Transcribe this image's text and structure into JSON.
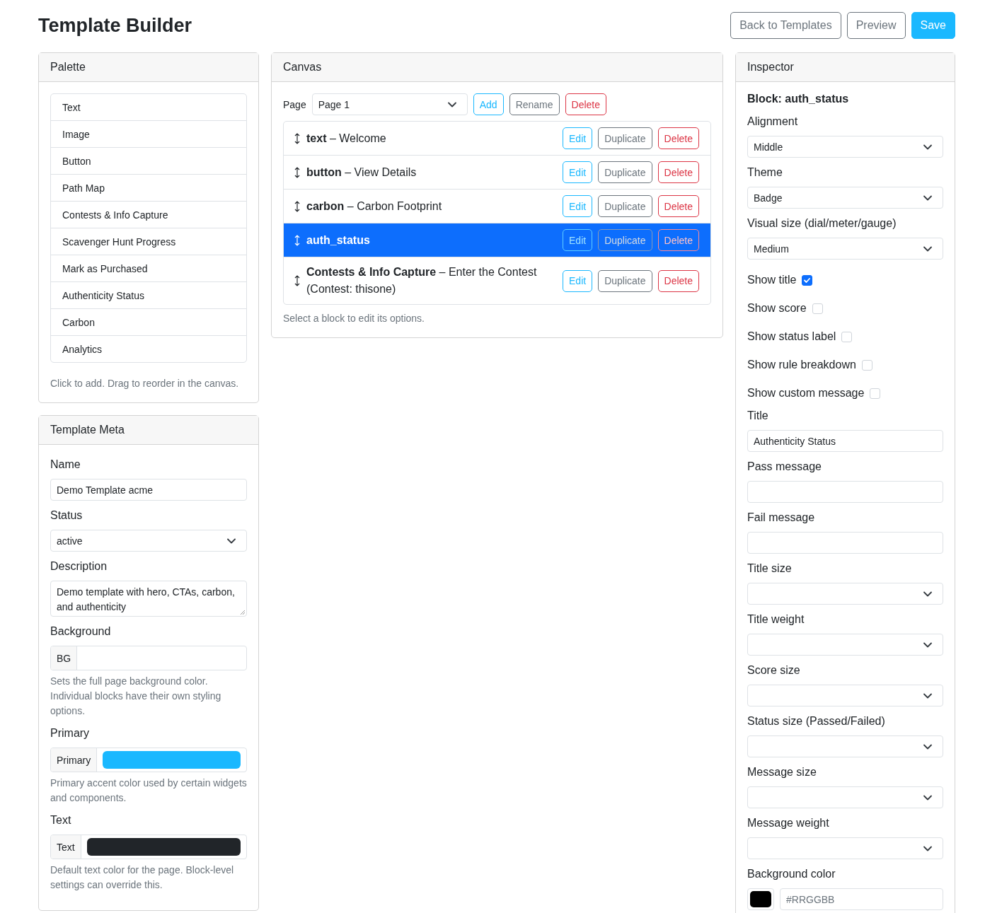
{
  "header": {
    "title": "Template Builder",
    "buttons": [
      {
        "label": "Back to Templates",
        "kind": "secondary"
      },
      {
        "label": "Preview",
        "kind": "secondary"
      },
      {
        "label": "Save",
        "kind": "primary"
      }
    ]
  },
  "palette": {
    "title": "Palette",
    "items": [
      "Text",
      "Image",
      "Button",
      "Path Map",
      "Contests & Info Capture",
      "Scavenger Hunt Progress",
      "Mark as Purchased",
      "Authenticity Status",
      "Carbon",
      "Analytics"
    ],
    "hint": "Click to add. Drag to reorder in the canvas."
  },
  "meta": {
    "title": "Template Meta",
    "fields": [
      {
        "kind": "text",
        "label": "Name",
        "value": "Demo Template acme"
      },
      {
        "kind": "select",
        "label": "Status",
        "value": "active"
      },
      {
        "kind": "textarea",
        "label": "Description",
        "value": "Demo template with hero, CTAs, carbon, and authenticity"
      },
      {
        "kind": "color_group",
        "label": "Background",
        "addon": "BG",
        "help": "Sets the full page background color. Individual blocks have their own styling options."
      },
      {
        "kind": "color_group",
        "label": "Primary",
        "addon": "Primary",
        "color": "#1ab8ff",
        "help": "Primary accent color used by certain widgets and components."
      },
      {
        "kind": "color_group",
        "label": "Text",
        "addon": "Text",
        "color": "#212529",
        "help": "Default text color for the page. Block-level settings can override this."
      }
    ]
  },
  "canvas": {
    "title": "Canvas",
    "page_label": "Page",
    "page": "Page 1",
    "page_buttons": [
      {
        "label": "Add",
        "kind": "info"
      },
      {
        "label": "Rename",
        "kind": "secondary"
      },
      {
        "label": "Delete",
        "kind": "danger"
      }
    ],
    "blocks": [
      {
        "label": "**text** – Welcome",
        "selected": false,
        "actions": [
          {
            "label": "Edit",
            "kind": "info"
          },
          {
            "label": "Duplicate",
            "kind": "secondary"
          },
          {
            "label": "Delete",
            "kind": "danger"
          }
        ]
      },
      {
        "label": "**button** – View Details",
        "selected": false,
        "actions": [
          {
            "label": "Edit",
            "kind": "info"
          },
          {
            "label": "Duplicate",
            "kind": "secondary"
          },
          {
            "label": "Delete",
            "kind": "danger"
          }
        ]
      },
      {
        "label": "**carbon** – Carbon Footprint",
        "selected": false,
        "actions": [
          {
            "label": "Edit",
            "kind": "info"
          },
          {
            "label": "Duplicate",
            "kind": "secondary"
          },
          {
            "label": "Delete",
            "kind": "danger"
          }
        ]
      },
      {
        "label": "**auth_status**",
        "selected": true,
        "actions": [
          {
            "label": "Edit",
            "kind": "info"
          },
          {
            "label": "Duplicate",
            "kind": "secondary"
          },
          {
            "label": "Delete",
            "kind": "danger"
          }
        ]
      },
      {
        "label": "**Contests & Info Capture** – Enter the Contest (Contest: thisone)",
        "selected": false,
        "actions": [
          {
            "label": "Edit",
            "kind": "info"
          },
          {
            "label": "Duplicate",
            "kind": "secondary"
          },
          {
            "label": "Delete",
            "kind": "danger"
          }
        ]
      }
    ],
    "hint": "Select a block to edit its options."
  },
  "inspector": {
    "title": "Inspector",
    "heading": "Block: auth_status",
    "fields": [
      {
        "kind": "select",
        "label": "Alignment",
        "value": "Middle"
      },
      {
        "kind": "select",
        "label": "Theme",
        "value": "Badge"
      },
      {
        "kind": "select",
        "label": "Visual size (dial/meter/gauge)",
        "value": "Medium"
      },
      {
        "kind": "checkbox",
        "label": "Show title",
        "checked": true
      },
      {
        "kind": "checkbox",
        "label": "Show score",
        "checked": false
      },
      {
        "kind": "checkbox",
        "label": "Show status label",
        "checked": false
      },
      {
        "kind": "checkbox",
        "label": "Show rule breakdown",
        "checked": false
      },
      {
        "kind": "checkbox",
        "label": "Show custom message",
        "checked": false
      },
      {
        "kind": "text",
        "label": "Title",
        "value": "Authenticity Status"
      },
      {
        "kind": "text",
        "label": "Pass message"
      },
      {
        "kind": "text",
        "label": "Fail message"
      },
      {
        "kind": "select",
        "label": "Title size"
      },
      {
        "kind": "select",
        "label": "Title weight"
      },
      {
        "kind": "select",
        "label": "Score size"
      },
      {
        "kind": "select",
        "label": "Status size (Passed/Failed)"
      },
      {
        "kind": "select",
        "label": "Message size"
      },
      {
        "kind": "select",
        "label": "Message weight"
      },
      {
        "kind": "color",
        "label": "Background color",
        "color": "#000000",
        "placeholder": "#RRGGBB"
      }
    ]
  }
}
